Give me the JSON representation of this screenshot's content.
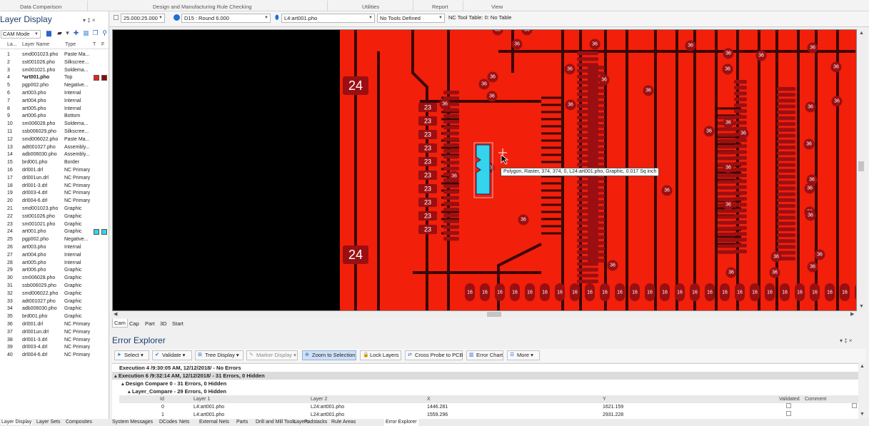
{
  "ribbon": {
    "groups": [
      "Data Comparison",
      "Design and Manufacturing Rule Checking",
      "Utilities",
      "Report",
      "View"
    ]
  },
  "layer_panel": {
    "title": "Layer Display",
    "pin": "▾ ‡ ×",
    "mode": "CAM Mode",
    "headers": [
      "La...",
      "Layer Name",
      "Type",
      "T",
      "F"
    ],
    "layers": [
      {
        "n": "1",
        "name": "smd001023.pho",
        "type": "Paste Ma..."
      },
      {
        "n": "2",
        "name": "sst001026.pho",
        "type": "Silkscree..."
      },
      {
        "n": "3",
        "name": "sm001021.pho",
        "type": "Soldema..."
      },
      {
        "n": "4",
        "name": "*art001.pho",
        "type": "Top",
        "sw": "#e8231f"
      },
      {
        "n": "5",
        "name": "pgp002.pho",
        "type": "Negative..."
      },
      {
        "n": "6",
        "name": "art003.pho",
        "type": "Internal"
      },
      {
        "n": "7",
        "name": "art004.pho",
        "type": "Internal"
      },
      {
        "n": "8",
        "name": "art005.pho",
        "type": "Internal"
      },
      {
        "n": "9",
        "name": "art006.pho",
        "type": "Bottom"
      },
      {
        "n": "10",
        "name": "sm006028.pho",
        "type": "Soldema..."
      },
      {
        "n": "11",
        "name": "ssb006029.pho",
        "type": "Silkscree..."
      },
      {
        "n": "12",
        "name": "smd006022.pho",
        "type": "Paste Ma..."
      },
      {
        "n": "13",
        "name": "adt001027.pho",
        "type": "Assembly..."
      },
      {
        "n": "14",
        "name": "adb006030.pho",
        "type": "Assembly..."
      },
      {
        "n": "15",
        "name": "brd001.pho",
        "type": "Border"
      },
      {
        "n": "16",
        "name": "drl001.drl",
        "type": "NC Primary"
      },
      {
        "n": "17",
        "name": "drl001un.drl",
        "type": "NC Primary"
      },
      {
        "n": "18",
        "name": "drl001-3.drl",
        "type": "NC Primary"
      },
      {
        "n": "19",
        "name": "drl003-4.drl",
        "type": "NC Primary"
      },
      {
        "n": "20",
        "name": "drl004-6.drl",
        "type": "NC Primary"
      },
      {
        "n": "21",
        "name": "smd001023.pho",
        "type": "Graphic"
      },
      {
        "n": "22",
        "name": "sst001026.pho",
        "type": "Graphic"
      },
      {
        "n": "23",
        "name": "sm001021.pho",
        "type": "Graphic"
      },
      {
        "n": "24",
        "name": "art001.pho",
        "type": "Graphic",
        "sw": "#32d6e8"
      },
      {
        "n": "25",
        "name": "pgp002.pho",
        "type": "Negative..."
      },
      {
        "n": "26",
        "name": "art003.pho",
        "type": "Internal"
      },
      {
        "n": "27",
        "name": "art004.pho",
        "type": "Internal"
      },
      {
        "n": "28",
        "name": "art005.pho",
        "type": "Internal"
      },
      {
        "n": "29",
        "name": "art006.pho",
        "type": "Graphic"
      },
      {
        "n": "30",
        "name": "sm006028.pho",
        "type": "Graphic"
      },
      {
        "n": "31",
        "name": "ssb006029.pho",
        "type": "Graphic"
      },
      {
        "n": "32",
        "name": "smd006022.pho",
        "type": "Graphic"
      },
      {
        "n": "33",
        "name": "adt001027.pho",
        "type": "Graphic"
      },
      {
        "n": "34",
        "name": "adb006030.pho",
        "type": "Graphic"
      },
      {
        "n": "35",
        "name": "brd001.pho",
        "type": "Graphic"
      },
      {
        "n": "36",
        "name": "drl001.drl",
        "type": "NC Primary"
      },
      {
        "n": "37",
        "name": "drl001un.drl",
        "type": "NC Primary"
      },
      {
        "n": "38",
        "name": "drl001-3.drl",
        "type": "NC Primary"
      },
      {
        "n": "39",
        "name": "drl003-4.drl",
        "type": "NC Primary"
      },
      {
        "n": "40",
        "name": "drl004-6.drl",
        "type": "NC Primary"
      }
    ],
    "bottom_tabs": [
      "Layer Display",
      "Layer Sets",
      "Composites"
    ]
  },
  "toolbar": {
    "grid": "25.000:25.000",
    "dcode": "D15 : Round 6.000",
    "layer": "L4:art001.pho",
    "tools": "No Tools Defined",
    "nc_table": "NC Tool Table: 0: No Table"
  },
  "canvas": {
    "tooltip": "Polygon, Raster, 374, 374, 0, L24:art001.pho, Graphic, 0.017 Sq inch",
    "label_24": "24",
    "label_23": "23",
    "label_36": "36",
    "label_16": "16",
    "tabs": [
      "Cam",
      "Cap",
      "Part",
      "3D",
      "Start"
    ]
  },
  "error_explorer": {
    "title": "Error Explorer",
    "pin": "▾ ‡ ×",
    "buttons": [
      "Select",
      "Validate",
      "Tree Display",
      "Marker Display",
      "Zoom to Selection",
      "Lock Layers",
      "Cross Probe to PCB",
      "Error Chart",
      "More"
    ],
    "tree": [
      "Execution 4 /9:30:05 AM, 12/12/2018/ - No Errors",
      "Execution 6 /9:32:14 AM, 12/12/2018/ - 31 Errors, 0 Hidden",
      "Design Compare 0 - 31 Errors, 0 Hidden",
      "Layer_Compare - 29 Errors, 0 Hidden"
    ],
    "grid_headers": [
      "Id",
      "Layer 1",
      "Layer 2",
      "X",
      "Y",
      "Validated",
      "Comment"
    ],
    "rows": [
      {
        "id": "0",
        "l1": "L4:art001.pho",
        "l2": "L24:art001.pho",
        "x": "1446.281",
        "y": "1621.159"
      },
      {
        "id": "1",
        "l1": "L4:art001.pho",
        "l2": "L24:art001.pho",
        "x": "1559.296",
        "y": "2931.228"
      }
    ]
  },
  "bottom_tabs": [
    "System Messages",
    "DCodes",
    "Nets",
    "External Nets",
    "Parts",
    "Drill and Mill Tools",
    "Layers",
    "Padstacks",
    "Rule Areas",
    "Error Explorer"
  ],
  "colors": {
    "copper": "#f21f0a",
    "trace_dark": "#3a0704",
    "pad": "#9b0f12",
    "highlight": "#33d4ec",
    "accent": "#1f6fd6"
  }
}
